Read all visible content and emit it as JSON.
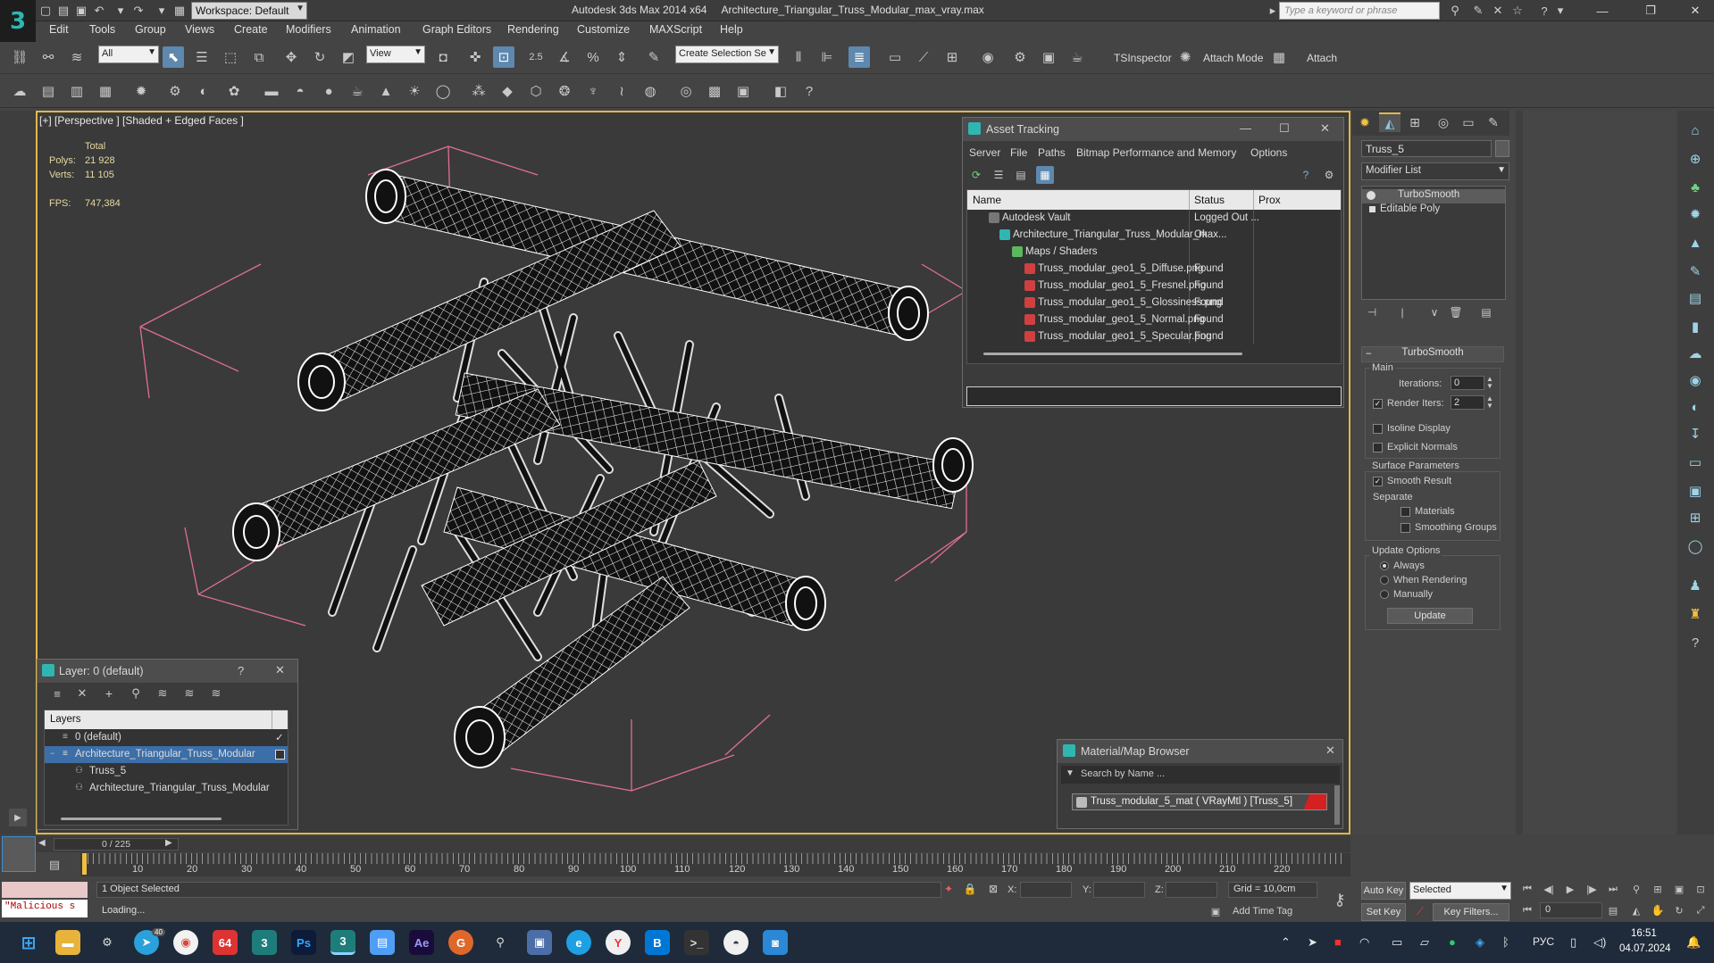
{
  "titlebar": {
    "workspace_label": "Workspace: Default",
    "app_title": "Autodesk 3ds Max  2014 x64",
    "file_title": "Architecture_Triangular_Truss_Modular_max_vray.max",
    "search_placeholder": "Type a keyword or phrase"
  },
  "menubar": {
    "items": [
      "Edit",
      "Tools",
      "Group",
      "Views",
      "Create",
      "Modifiers",
      "Animation",
      "Graph Editors",
      "Rendering",
      "Customize",
      "MAXScript",
      "Help"
    ]
  },
  "toolbar": {
    "selection_filter": "All",
    "ref_coord": "View",
    "snap_value": "2.5",
    "named_selection": "Create Selection Se",
    "tsinspector_label": "TSInspector",
    "attach_mode_label": "Attach Mode",
    "attach_label": "Attach"
  },
  "viewport": {
    "label": "[+] [Perspective ] [Shaded + Edged Faces ]",
    "stats_total_label": "Total",
    "polys_label": "Polys:",
    "polys_value": "21 928",
    "verts_label": "Verts:",
    "verts_value": "11 105",
    "fps_label": "FPS:",
    "fps_value": "747,384"
  },
  "asset_tracking": {
    "title": "Asset Tracking",
    "menu": [
      "Server",
      "File",
      "Paths",
      "Bitmap Performance and Memory",
      "Options"
    ],
    "columns": [
      "Name",
      "Status",
      "Prox"
    ],
    "rows": [
      {
        "name": "Autodesk Vault",
        "status": "Logged Out ..."
      },
      {
        "name": "Architecture_Triangular_Truss_Modular_max...",
        "status": "Ok"
      },
      {
        "name": "Maps / Shaders",
        "status": ""
      },
      {
        "name": "Truss_modular_geo1_5_Diffuse.png",
        "status": "Found"
      },
      {
        "name": "Truss_modular_geo1_5_Fresnel.png",
        "status": "Found"
      },
      {
        "name": "Truss_modular_geo1_5_Glossiness.png",
        "status": "Found"
      },
      {
        "name": "Truss_modular_geo1_5_Normal.png",
        "status": "Found"
      },
      {
        "name": "Truss_modular_geo1_5_Specular.png",
        "status": "Found"
      }
    ]
  },
  "command_panel": {
    "object_name": "Truss_5",
    "modifier_list_label": "Modifier List",
    "stack": [
      "TurboSmooth",
      "Editable Poly"
    ],
    "rollout_title": "TurboSmooth",
    "main_group": "Main",
    "iterations_label": "Iterations:",
    "iterations_value": "0",
    "render_iters_label": "Render Iters:",
    "render_iters_value": "2",
    "isoline_label": "Isoline Display",
    "explicit_normals_label": "Explicit Normals",
    "surface_group": "Surface Parameters",
    "smooth_result_label": "Smooth Result",
    "separate_label": "Separate",
    "materials_label": "Materials",
    "smoothing_groups_label": "Smoothing Groups",
    "update_group": "Update Options",
    "always_label": "Always",
    "when_rendering_label": "When Rendering",
    "manually_label": "Manually",
    "update_button": "Update"
  },
  "layer_window": {
    "title": "Layer: 0 (default)",
    "help": "?",
    "header": "Layers",
    "rows": [
      {
        "name": "0 (default)"
      },
      {
        "name": "Architecture_Triangular_Truss_Modular"
      },
      {
        "name": "Truss_5"
      },
      {
        "name": "Architecture_Triangular_Truss_Modular"
      }
    ]
  },
  "material_browser": {
    "title": "Material/Map Browser",
    "search_placeholder": "Search by Name ...",
    "item": "Truss_modular_5_mat  ( VRayMtl )  [Truss_5]"
  },
  "timeline": {
    "frame_counter": "0 / 225",
    "ticks": [
      "10",
      "20",
      "30",
      "40",
      "50",
      "60",
      "70",
      "80",
      "90",
      "100",
      "110",
      "120",
      "130",
      "140",
      "150",
      "160",
      "170",
      "180",
      "190",
      "200",
      "210",
      "220"
    ]
  },
  "status": {
    "maxscript": "\"Malicious s",
    "selection": "1 Object Selected",
    "prompt": "Loading...",
    "x_label": "X:",
    "y_label": "Y:",
    "z_label": "Z:",
    "grid": "Grid = 10,0cm",
    "add_time_tag": "Add Time Tag",
    "auto_key": "Auto Key",
    "set_key": "Set Key",
    "key_mode": "Selected",
    "key_filters": "Key Filters...",
    "current_frame": "0"
  },
  "taskbar": {
    "badge_64": "64",
    "telegram_badge": "40",
    "lang": "РУС",
    "time": "16:51",
    "date": "04.07.2024"
  },
  "colors": {
    "viewport_border": "#e0b84a",
    "selection_blue": "#3c6ea8",
    "bounding_box": "#e07090",
    "wire": "#ffffff"
  }
}
